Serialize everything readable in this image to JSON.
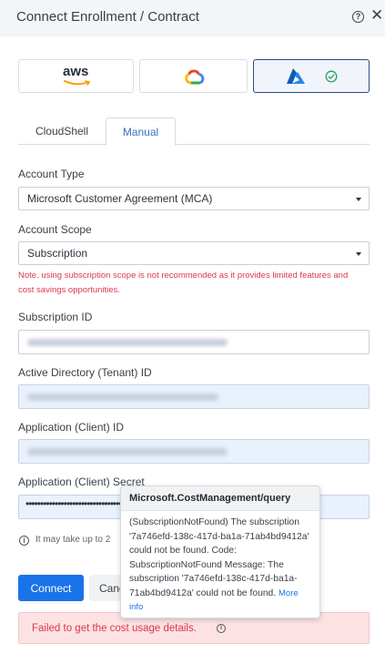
{
  "header": {
    "title": "Connect Enrollment / Contract",
    "help_glyph": "?",
    "close_glyph": "✕"
  },
  "providers": [
    {
      "name": "aws",
      "label": "aws"
    },
    {
      "name": "gcp",
      "icon": "google-cloud-logo-icon"
    },
    {
      "name": "azure",
      "icon": "azure-logo-icon",
      "selected": true,
      "selected_icon": "check-circle-icon"
    }
  ],
  "tabs": [
    {
      "label": "CloudShell"
    },
    {
      "label": "Manual",
      "active": true
    }
  ],
  "form": {
    "account_type_label": "Account Type",
    "account_type_value": "Microsoft Customer Agreement (MCA)",
    "account_scope_label": "Account Scope",
    "account_scope_value": "Subscription",
    "scope_note": "Note. using subscription scope is not recommended as it provides limited features and cost savings opportunities.",
    "subscription_id_label": "Subscription ID",
    "tenant_id_label": "Active Directory (Tenant) ID",
    "client_id_label": "Application (Client) ID",
    "client_secret_label": "Application (Client) Secret",
    "client_secret_mask": "••••••••••••••••••••••••••••••••••••••••••",
    "info_text": "It may take up to 2"
  },
  "actions": {
    "connect_label": "Connect",
    "cancel_label": "Canc"
  },
  "error": {
    "message": "Failed to get the cost usage details."
  },
  "popover": {
    "title": "Microsoft.CostManagement/query",
    "body": "(SubscriptionNotFound) The subscription '7a746efd-138c-417d-ba1a-71ab4bd9412a' could not be found. Code: SubscriptionNotFound Message: The subscription '7a746efd-138c-417d-ba1a-71ab4bd9412a' could not be found.",
    "link": "More info"
  },
  "colors": {
    "primary": "#1a73e8",
    "error": "#d8394b",
    "error_bg": "#fde2e4",
    "azure_blue": "#0078d4",
    "success": "#2e9f5a"
  }
}
